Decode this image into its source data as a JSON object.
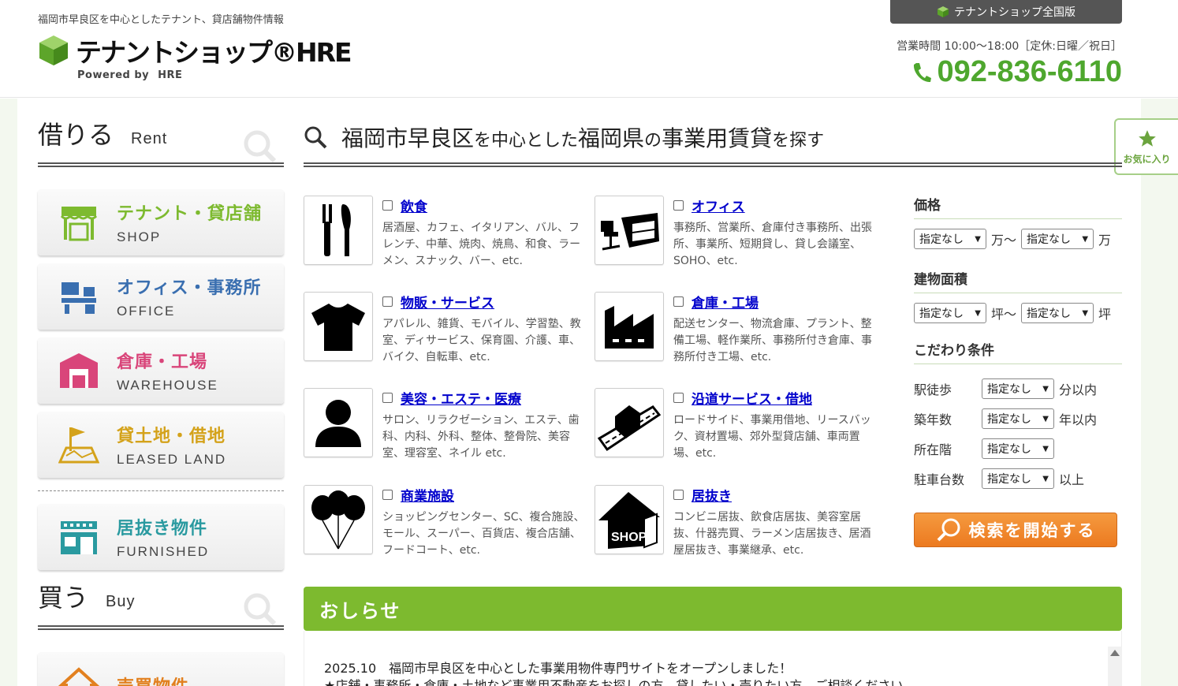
{
  "header": {
    "tagline": "福岡市早良区を中心としたテナント、貸店舗物件情報",
    "logo_text": "テナントショップ®HRE",
    "powered_by": "Powered by",
    "powered_brand": "HRE",
    "national_button": "テナントショップ全国版",
    "hours": "営業時間 10:00～18:00［定休:日曜／祝日］",
    "phone": "092-836-6110"
  },
  "favorite": {
    "label": "お気に入り"
  },
  "sidebar": {
    "rent": {
      "jp": "借りる",
      "en": "Rent"
    },
    "categories": [
      {
        "jp": "テナント・貸店舗",
        "en": "SHOP",
        "color": "#7dba2f"
      },
      {
        "jp": "オフィス・事務所",
        "en": "OFFICE",
        "color": "#3a6fb0"
      },
      {
        "jp": "倉庫・工場",
        "en": "WAREHOUSE",
        "color": "#d9457a"
      },
      {
        "jp": "貸土地・借地",
        "en": "LEASED LAND",
        "color": "#d4a21a"
      },
      {
        "jp": "居抜き物件",
        "en": "FURNISHED",
        "color": "#2a9aa0"
      }
    ],
    "buy": {
      "jp": "買う",
      "en": "Buy"
    },
    "buy_item": {
      "jp": "売買物件",
      "color": "#e2801f"
    }
  },
  "main": {
    "title_a": "福岡市早良区",
    "title_b": "を中心とした",
    "title_c": "福岡県",
    "title_d": "の",
    "title_e": "事業用賃貸",
    "title_f": "を探す",
    "types": [
      {
        "title": "飲食",
        "desc": "居酒屋、カフェ、イタリアン、バル、フレンチ、中華、焼肉、焼鳥、和食、ラーメン、スナック、バー、etc.",
        "icon": "fork-knife-icon"
      },
      {
        "title": "オフィス",
        "desc": "事務所、営業所、倉庫付き事務所、出張所、事業所、短期貸し、貸し会議室、SOHO、etc.",
        "icon": "office-desk-icon"
      },
      {
        "title": "物販・サービス",
        "desc": "アパレル、雑貨、モバイル、学習塾、教室、ディサービス、保育園、介護、車、バイク、自転車、etc.",
        "icon": "tshirt-icon"
      },
      {
        "title": "倉庫・工場",
        "desc": "配送センター、物流倉庫、プラント、整備工場、軽作業所、事務所付き倉庫、事務所付き工場、etc.",
        "icon": "factory-icon"
      },
      {
        "title": "美容・エステ・医療",
        "desc": "サロン、リラクゼーション、エステ、歯科、内科、外科、整体、整骨院、美容室、理容室、ネイル etc.",
        "icon": "person-icon"
      },
      {
        "title": "沿道サービス・借地",
        "desc": "ロードサイド、事業用借地、リースバック、資材置場、郊外型貸店舗、車両置場、etc.",
        "icon": "roadside-icon"
      },
      {
        "title": "商業施設",
        "desc": "ショッピングセンター、SC、複合施設、モール、スーパー、百貨店、複合店舗、フードコート、etc.",
        "icon": "balloons-icon"
      },
      {
        "title": "居抜き",
        "desc": "コンビニ居抜、飲食店居抜、美容室居抜、什器売買、ラーメン店居抜き、居酒屋居抜き、事業継承、etc.",
        "icon": "shop-house-icon"
      }
    ]
  },
  "search": {
    "price_label": "価格",
    "area_label": "建物面積",
    "cond_label": "こだわり条件",
    "select_default": "指定なし",
    "man": "万",
    "tsubo": "坪",
    "tilde": "～",
    "conds": [
      {
        "label": "駅徒歩",
        "unit": "分以内"
      },
      {
        "label": "築年数",
        "unit": "年以内"
      },
      {
        "label": "所在階",
        "unit": ""
      },
      {
        "label": "駐車台数",
        "unit": "以上"
      }
    ],
    "button": "検索を開始する"
  },
  "news": {
    "title": "おしらせ",
    "line1": "2025.10　福岡市早良区を中心とした事業用物件専門サイトをオープンしました！",
    "line2": "★店舗・事務所・倉庫・土地など事業用不動産をお探しの方、貸したい・売りたい方、ご相談ください。"
  }
}
